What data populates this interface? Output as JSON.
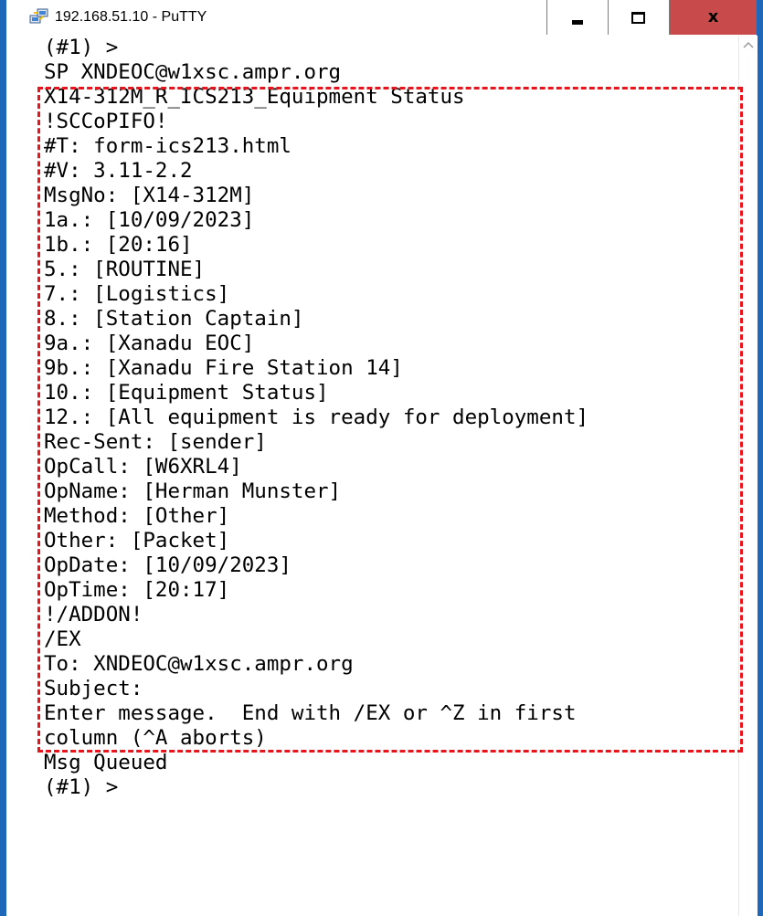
{
  "window": {
    "title": "192.168.51.10 - PuTTY",
    "close_label": "x",
    "accent_color": "#1f67b8",
    "highlight_color": "#e8141b"
  },
  "icons": {
    "app": "putty-computers-icon",
    "minimize": "minimize-icon",
    "maximize": "maximize-icon",
    "close": "close-icon",
    "scroll_up": "chevron-up-icon"
  },
  "terminal": {
    "lines": [
      "(#1) >",
      "SP XNDEOC@w1xsc.ampr.org",
      "X14-312M_R_ICS213_Equipment Status",
      "!SCCoPIFO!",
      "#T: form-ics213.html",
      "#V: 3.11-2.2",
      "MsgNo: [X14-312M]",
      "1a.: [10/09/2023]",
      "1b.: [20:16]",
      "5.: [ROUTINE]",
      "7.: [Logistics]",
      "8.: [Station Captain]",
      "9a.: [Xanadu EOC]",
      "9b.: [Xanadu Fire Station 14]",
      "10.: [Equipment Status]",
      "12.: [All equipment is ready for deployment]",
      "Rec-Sent: [sender]",
      "OpCall: [W6XRL4]",
      "OpName: [Herman Munster]",
      "Method: [Other]",
      "Other: [Packet]",
      "OpDate: [10/09/2023]",
      "OpTime: [20:17]",
      "!/ADDON!",
      "/EX",
      "To: XNDEOC@w1xsc.ampr.org",
      "Subject:",
      "Enter message.  End with /EX or ^Z in first",
      "column (^A aborts)",
      "Msg Queued",
      "(#1) >"
    ]
  }
}
